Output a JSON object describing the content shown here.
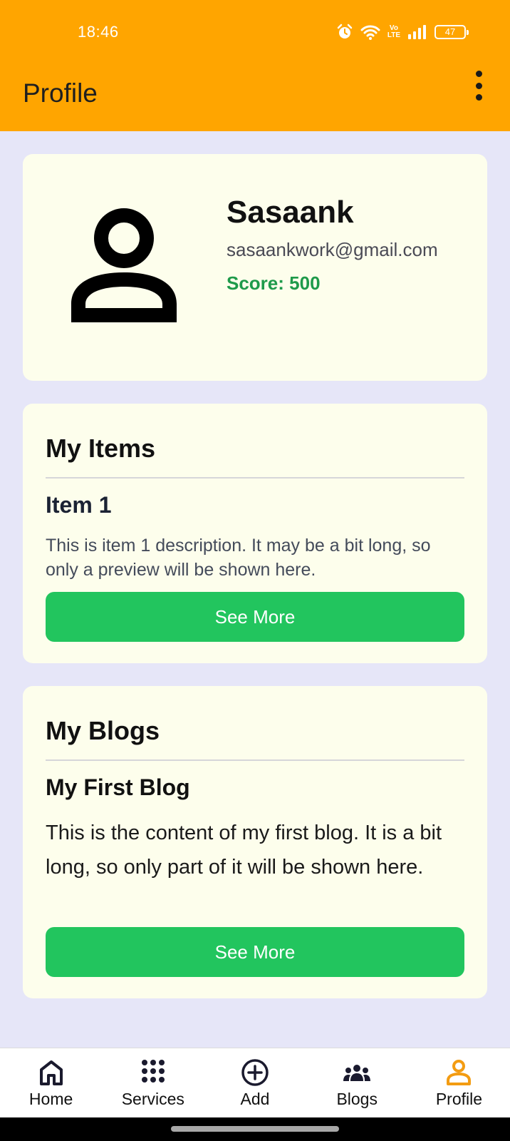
{
  "status_bar": {
    "time": "18:46",
    "volte_top": "Vo",
    "volte_bottom": "LTE",
    "battery": "47"
  },
  "header": {
    "title": "Profile",
    "menu_icon": "more-vertical-icon",
    "background": "#ffa500"
  },
  "profile": {
    "avatar_icon": "person-icon",
    "name": "Sasaank",
    "email": "sasaankwork@gmail.com",
    "score": "Score: 500"
  },
  "items_section": {
    "title": "My Items",
    "entries": [
      {
        "title": "Item 1",
        "description": "This is item 1 description. It may be a bit long, so only a preview will be shown here.",
        "button": "See More"
      }
    ]
  },
  "blogs_section": {
    "title": "My Blogs",
    "entries": [
      {
        "title": "My First Blog",
        "description": "This is the content of my first blog. It is a bit long, so only part of it will be shown here.",
        "button": "See More"
      }
    ]
  },
  "bottom_nav": {
    "items": [
      {
        "label": "Home",
        "icon": "home-icon"
      },
      {
        "label": "Services",
        "icon": "grid-dots-icon"
      },
      {
        "label": "Add",
        "icon": "add-circle-icon"
      },
      {
        "label": "Blogs",
        "icon": "group-icon"
      },
      {
        "label": "Profile",
        "icon": "person-icon"
      }
    ],
    "active": "Profile",
    "active_color": "#f39c12"
  },
  "colors": {
    "accent_green": "#22c55e",
    "score_green": "#1e9a4a",
    "card_bg": "#fdfeec",
    "page_bg": "#e6e6f8"
  }
}
